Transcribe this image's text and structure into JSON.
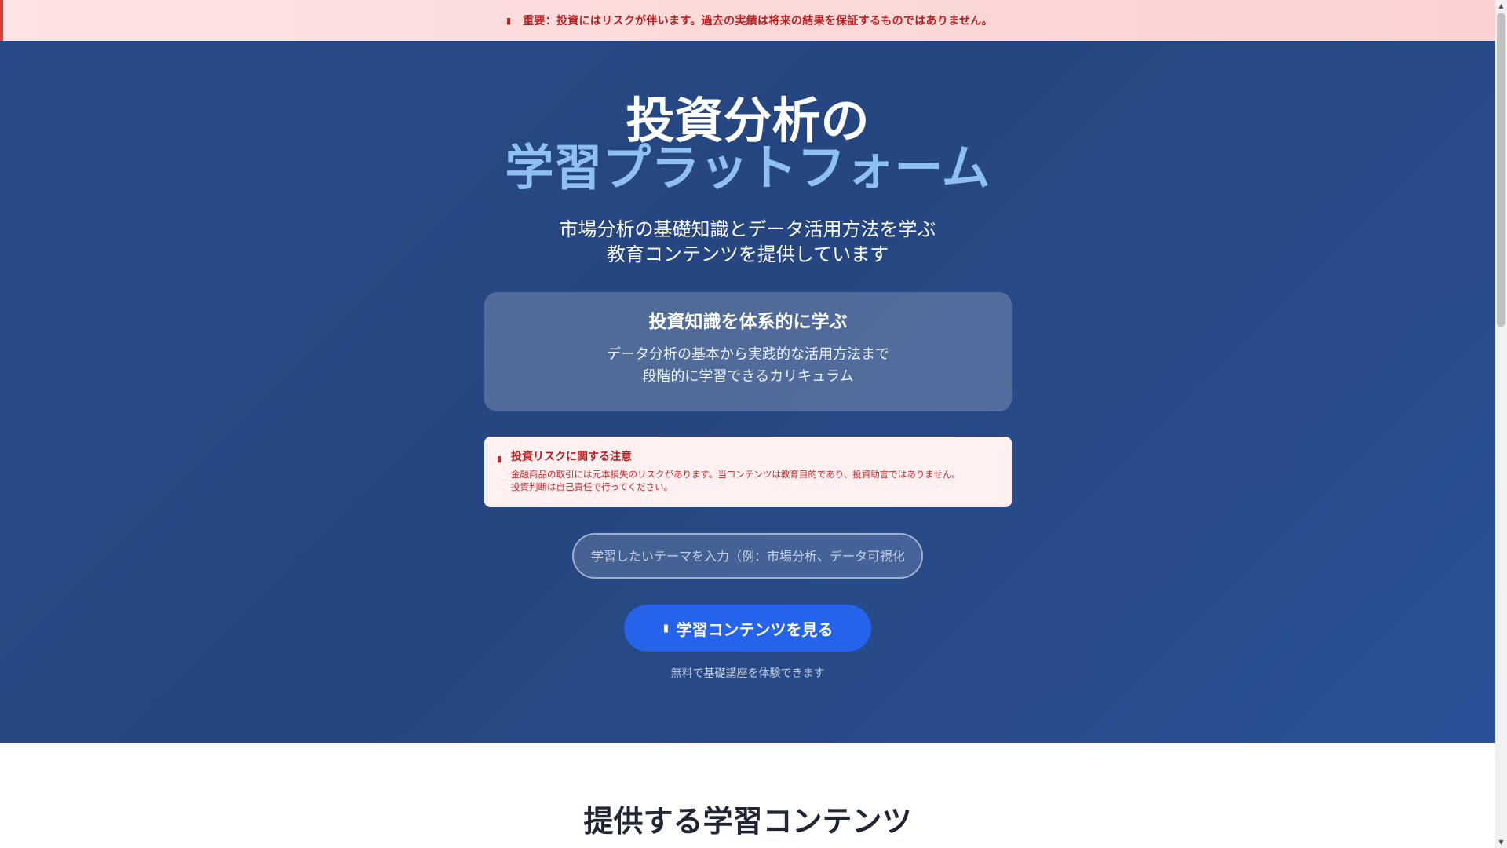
{
  "top_banner": {
    "icon": "warning-icon",
    "text": "重要：投資にはリスクが伴います。過去の実績は将来の結果を保証するものではありません。"
  },
  "hero": {
    "title_line1": "投資分析の",
    "title_line2": "学習プラットフォーム",
    "subtitle_line1": "市場分析の基礎知識とデータ活用方法を学ぶ",
    "subtitle_line2": "教育コンテンツを提供しています",
    "feature": {
      "title": "投資知識を体系的に学ぶ",
      "text_line1": "データ分析の基本から実践的な活用方法まで",
      "text_line2": "段階的に学習できるカリキュラム"
    },
    "risk_notice": {
      "icon": "alert-icon",
      "title": "投資リスクに関する注意",
      "text_line1": "金融商品の取引には元本損失のリスクがあります。当コンテンツは教育目的であり、投資助言ではありません。",
      "text_line2": "投資判断は自己責任で行ってください。"
    },
    "search": {
      "placeholder": "学習したいテーマを入力（例：市場分析、データ可視化）",
      "value": ""
    },
    "cta": {
      "icon": "play-icon",
      "label": "学習コンテンツを見る"
    },
    "cta_note": "無料で基礎講座を体験できます"
  },
  "section": {
    "title": "提供する学習コンテンツ"
  },
  "colors": {
    "hero_bg": "#284a8a",
    "accent_title": "#8ec1f2",
    "cta": "#2563eb",
    "warning_text": "#b81f1f",
    "banner_bg": "#fde3e3"
  }
}
